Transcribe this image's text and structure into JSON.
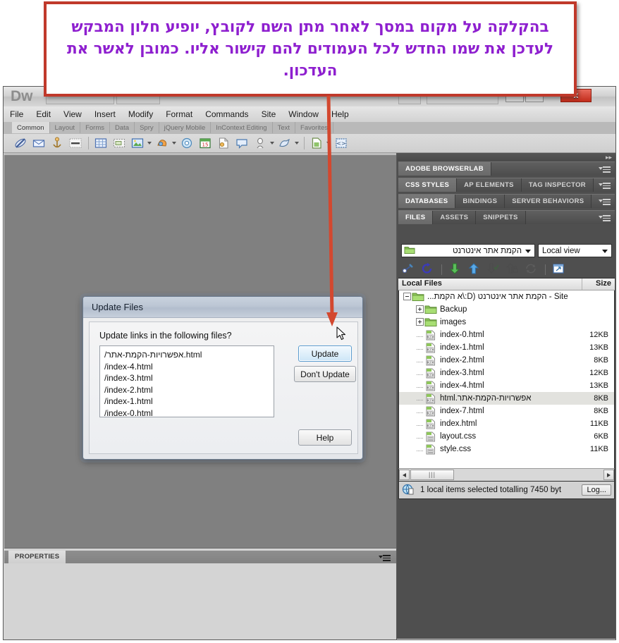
{
  "callout": {
    "text": "בהקלקה על מקום במסך לאחר מתן השם לקובץ, יופיע חלון המבקש לעדכן את שמו החדש לכל העמודים להם קישור אליו. כמובן לאשר את העדכון.",
    "border_color": "#c0392b",
    "text_color": "#8e1fcf"
  },
  "app": {
    "logo": "Dw",
    "close_label": "x",
    "menus": [
      {
        "label": "File"
      },
      {
        "label": "Edit"
      },
      {
        "label": "View"
      },
      {
        "label": "Insert"
      },
      {
        "label": "Modify"
      },
      {
        "label": "Format"
      },
      {
        "label": "Commands"
      },
      {
        "label": "Site"
      },
      {
        "label": "Window"
      },
      {
        "label": "Help"
      }
    ],
    "insert_tabs": [
      {
        "label": "Common",
        "active": true
      },
      {
        "label": "Layout",
        "active": false
      },
      {
        "label": "Forms",
        "active": false
      },
      {
        "label": "Data",
        "active": false
      },
      {
        "label": "Spry",
        "active": false
      },
      {
        "label": "jQuery Mobile",
        "active": false
      },
      {
        "label": "InContext Editing",
        "active": false
      },
      {
        "label": "Text",
        "active": false
      },
      {
        "label": "Favorites",
        "active": false
      }
    ]
  },
  "properties": {
    "tab_label": "PROPERTIES"
  },
  "dock": {
    "groups": [
      {
        "tabs": [
          {
            "label": "ADOBE BROWSERLAB",
            "active": true
          }
        ]
      },
      {
        "tabs": [
          {
            "label": "CSS STYLES",
            "active": true
          },
          {
            "label": "AP ELEMENTS",
            "active": false
          },
          {
            "label": "TAG INSPECTOR",
            "active": false
          }
        ]
      },
      {
        "tabs": [
          {
            "label": "DATABASES",
            "active": true
          },
          {
            "label": "BINDINGS",
            "active": false
          },
          {
            "label": "SERVER BEHAVIORS",
            "active": false
          }
        ]
      },
      {
        "tabs": [
          {
            "label": "FILES",
            "active": true
          },
          {
            "label": "ASSETS",
            "active": false
          },
          {
            "label": "SNIPPETS",
            "active": false
          }
        ]
      }
    ]
  },
  "files_panel": {
    "site_select": "הקמת אתר אינטרנט",
    "view_select": "Local view",
    "columns": {
      "name": "Local Files",
      "size": "Size"
    },
    "rows": [
      {
        "name": "Site - הקמת אתר אינטרנט (D:\\א הקמת...",
        "size": "",
        "indent": 0,
        "type": "site",
        "twisty": "minus",
        "selected": false,
        "rtl": true
      },
      {
        "name": "Backup",
        "size": "",
        "indent": 1,
        "type": "folder",
        "twisty": "plus",
        "selected": false,
        "rtl": false
      },
      {
        "name": "images",
        "size": "",
        "indent": 1,
        "type": "folder",
        "twisty": "plus",
        "selected": false,
        "rtl": false
      },
      {
        "name": "index-0.html",
        "size": "12KB",
        "indent": 1,
        "type": "html",
        "twisty": "none",
        "selected": false,
        "rtl": false
      },
      {
        "name": "index-1.html",
        "size": "13KB",
        "indent": 1,
        "type": "html",
        "twisty": "none",
        "selected": false,
        "rtl": false
      },
      {
        "name": "index-2.html",
        "size": "8KB",
        "indent": 1,
        "type": "html",
        "twisty": "none",
        "selected": false,
        "rtl": false
      },
      {
        "name": "index-3.html",
        "size": "12KB",
        "indent": 1,
        "type": "html",
        "twisty": "none",
        "selected": false,
        "rtl": false
      },
      {
        "name": "index-4.html",
        "size": "13KB",
        "indent": 1,
        "type": "html",
        "twisty": "none",
        "selected": false,
        "rtl": false
      },
      {
        "name": "אפשרויות-הקמת-אתר.html",
        "size": "8KB",
        "indent": 1,
        "type": "html",
        "twisty": "none",
        "selected": true,
        "rtl": true
      },
      {
        "name": "index-7.html",
        "size": "8KB",
        "indent": 1,
        "type": "html",
        "twisty": "none",
        "selected": false,
        "rtl": false
      },
      {
        "name": "index.html",
        "size": "11KB",
        "indent": 1,
        "type": "html",
        "twisty": "none",
        "selected": false,
        "rtl": false
      },
      {
        "name": "layout.css",
        "size": "6KB",
        "indent": 1,
        "type": "css",
        "twisty": "none",
        "selected": false,
        "rtl": false
      },
      {
        "name": "style.css",
        "size": "11KB",
        "indent": 1,
        "type": "css",
        "twisty": "none",
        "selected": false,
        "rtl": false
      }
    ],
    "scroll_thumb_glyph": "|||",
    "status_text": "1 local items selected totalling 7450 byt",
    "log_button": "Log..."
  },
  "dialog": {
    "title": "Update Files",
    "question": "Update links in the following files?",
    "files": [
      "/אפשרויות-הקמת-אתר.html",
      "/index-4.html",
      "/index-3.html",
      "/index-2.html",
      "/index-1.html",
      "/index-0.html"
    ],
    "buttons": {
      "update": "Update",
      "dont_update": "Don't Update",
      "help": "Help"
    }
  }
}
